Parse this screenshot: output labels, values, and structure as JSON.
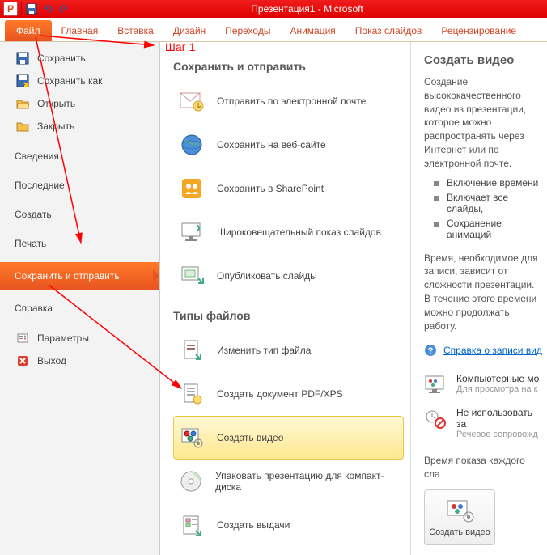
{
  "titlebar": {
    "title": "Презентация1 - Microsoft"
  },
  "ribbon": {
    "file": "Файл",
    "tabs": [
      "Главная",
      "Вставка",
      "Дизайн",
      "Переходы",
      "Анимация",
      "Показ слайдов",
      "Рецензирование"
    ]
  },
  "leftnav": {
    "save": "Сохранить",
    "saveas": "Сохранить как",
    "open": "Открыть",
    "close": "Закрыть",
    "info": "Сведения",
    "recent": "Последние",
    "new": "Создать",
    "print": "Печать",
    "saveandsend": "Сохранить и отправить",
    "help": "Справка",
    "options": "Параметры",
    "exit": "Выход"
  },
  "mid": {
    "section1": "Сохранить и отправить",
    "email": "Отправить по электронной почте",
    "web": "Сохранить на веб-сайте",
    "sharepoint": "Сохранить в SharePoint",
    "broadcast": "Широковещательный показ слайдов",
    "publish": "Опубликовать слайды",
    "section2": "Типы файлов",
    "changetype": "Изменить тип файла",
    "pdfxps": "Создать документ PDF/XPS",
    "createvideo": "Создать видео",
    "packagecd": "Упаковать презентацию для компакт-диска",
    "handouts": "Создать выдачи"
  },
  "right": {
    "heading": "Создать видео",
    "desc": "Создание высококачественного видео из презентации, которое можно распространять через Интернет или по электронной почте.",
    "bul1": "Включение времени ",
    "bul2": "Включает все слайды,",
    "bul3": "Сохранение анимаций",
    "timingnote": "Время, необходимое для записи, зависит от сложности презентации. В течение этого времени можно продолжать работу.",
    "helplink": "Справка о записи вид",
    "opt1_t": "Компьютерные мо",
    "opt1_s": "Для просмотра на к",
    "opt2_t": "Не использовать за",
    "opt2_s": "Речевое сопровожд",
    "durlabel": "Время показа каждого сла",
    "btn": "Создать видео"
  },
  "annotation": {
    "step1": "Шаг 1"
  }
}
